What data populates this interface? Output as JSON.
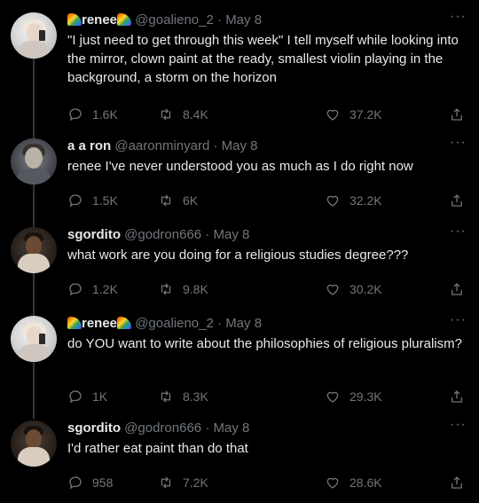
{
  "tweets": [
    {
      "display_name": "renee",
      "handle": "@goalieno_2",
      "separator": "·",
      "date": "May 8",
      "text": "\"I just need to get through this week\" I tell myself while looking into the mirror, clown paint at the ready, smallest violin playing in the background, a storm on the horizon",
      "replies": "1.6K",
      "retweets": "8.4K",
      "likes": "37.2K",
      "avatar_icon": "avatar-renee",
      "name_emoji": "rainbow-icon"
    },
    {
      "display_name": "a a ron",
      "handle": "@aaronminyard",
      "separator": "·",
      "date": "May 8",
      "text": "renee I've never understood you as much as I do right now",
      "replies": "1.5K",
      "retweets": "6K",
      "likes": "32.2K",
      "avatar_icon": "avatar-aaron"
    },
    {
      "display_name": "sgordito",
      "handle": "@godron666",
      "separator": "·",
      "date": "May 8",
      "text": "what work are you doing for a religious studies degree???",
      "replies": "1.2K",
      "retweets": "9.8K",
      "likes": "30.2K",
      "avatar_icon": "avatar-sgordito"
    },
    {
      "display_name": "renee",
      "handle": "@goalieno_2",
      "separator": "·",
      "date": "May 8",
      "text": "do YOU want to write about the philosophies of religious pluralism?",
      "replies": "1K",
      "retweets": "8.3K",
      "likes": "29.3K",
      "avatar_icon": "avatar-renee",
      "name_emoji": "rainbow-icon"
    },
    {
      "display_name": "sgordito",
      "handle": "@godron666",
      "separator": "·",
      "date": "May 8",
      "text": "I'd rather eat paint than do that",
      "replies": "958",
      "retweets": "7.2K",
      "likes": "28.6K",
      "avatar_icon": "avatar-sgordito"
    }
  ],
  "more_label": "···",
  "colors": {
    "background": "#000000",
    "text": "#e7e9ea",
    "muted": "#71767b",
    "thread_line": "#333639"
  }
}
